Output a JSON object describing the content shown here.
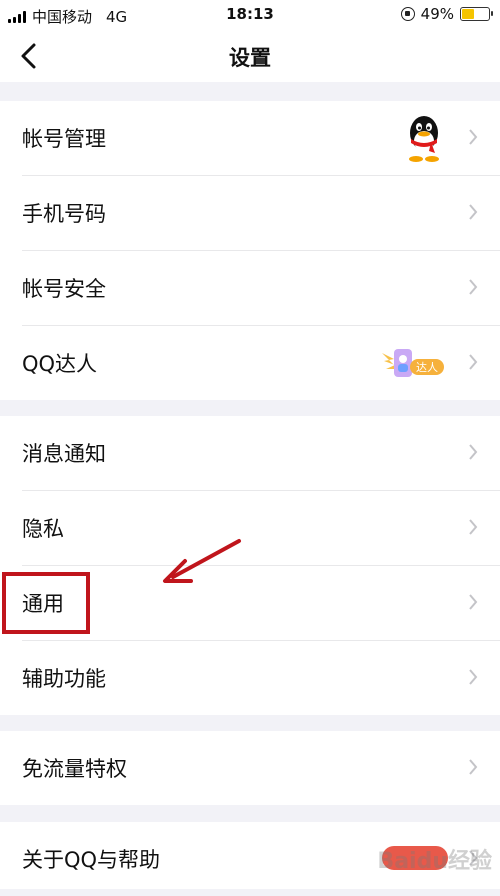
{
  "status_bar": {
    "carrier": "中国移动",
    "network": "4G",
    "time": "18:13",
    "battery_percent": "49%",
    "battery_level": 0.49
  },
  "nav": {
    "title": "设置"
  },
  "groups": [
    {
      "items": [
        {
          "label": "帐号管理",
          "icon": "qq-penguin-avatar"
        },
        {
          "label": "手机号码"
        },
        {
          "label": "帐号安全"
        },
        {
          "label": "QQ达人",
          "badge": "达人"
        }
      ]
    },
    {
      "items": [
        {
          "label": "消息通知"
        },
        {
          "label": "隐私"
        },
        {
          "label": "通用"
        },
        {
          "label": "辅助功能"
        }
      ]
    },
    {
      "items": [
        {
          "label": "免流量特权"
        }
      ]
    },
    {
      "items": [
        {
          "label": "关于QQ与帮助"
        }
      ]
    }
  ],
  "watermark": "Baidu经验",
  "colors": {
    "annotation_red": "#c0151c",
    "battery": "#f5c400",
    "background": "#f2f2f7"
  }
}
